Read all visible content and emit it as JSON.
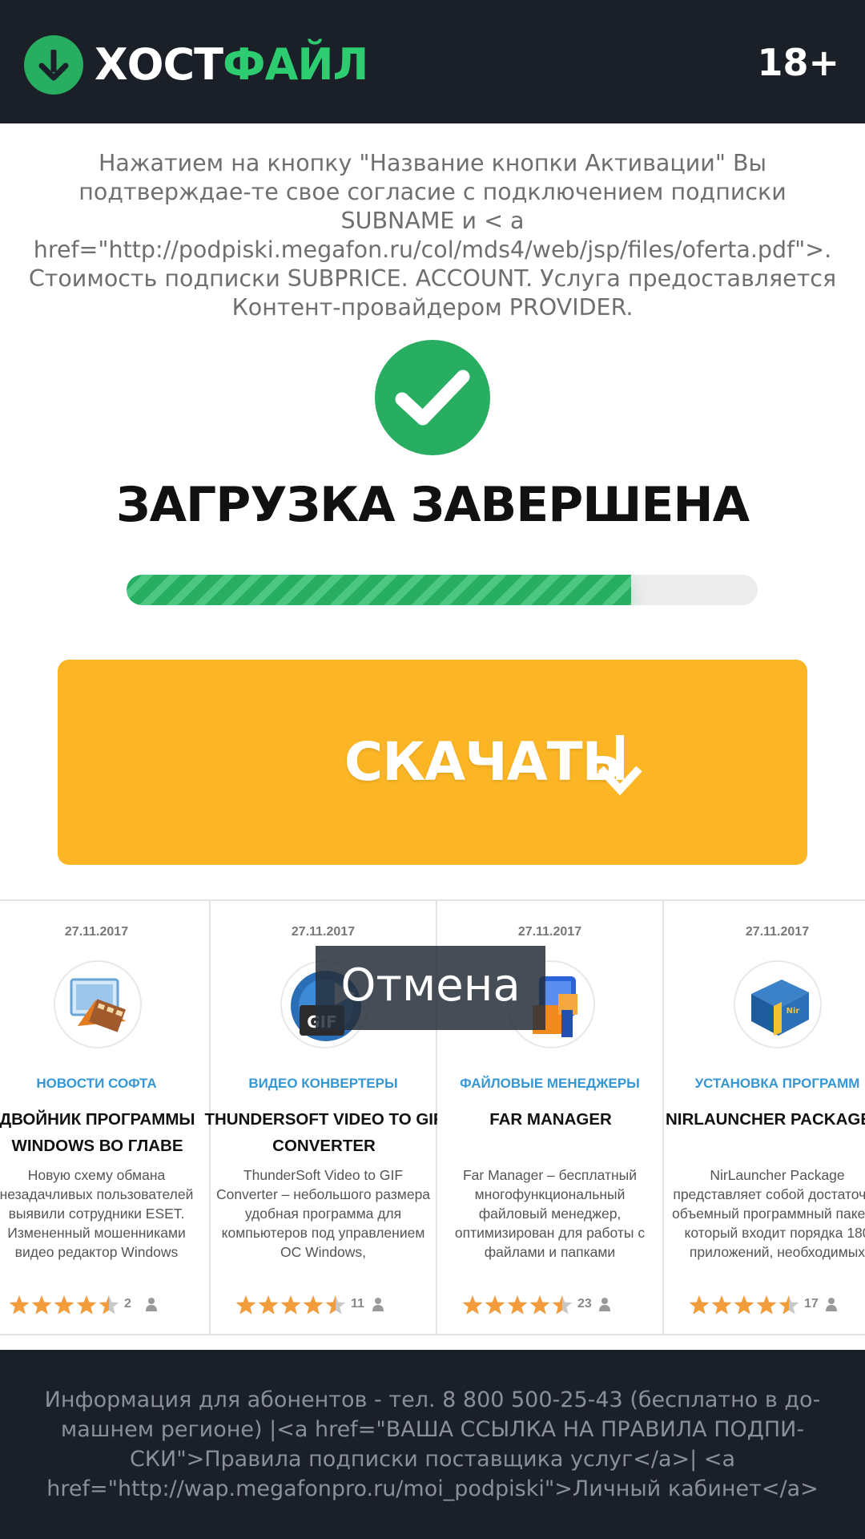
{
  "header": {
    "logo_part1": "ХОСТ",
    "logo_part2": "ФАЙЛ",
    "logo_icon": "download-arrow-icon",
    "age_badge": "18+"
  },
  "notice": "Нажатием на кнопку \"Название кнопки Активации\" Вы подтверждае-те свое согласие с подключением подписки SUBNAME и < a href=\"http://podpiski.megafon.ru/col/mds4/web/jsp/files/oferta.pdf\">. Стоимость подписки SUBPRICE. ACCOUNT. Услуга предоставляется Контент-провайдером PROVIDER.",
  "status": {
    "icon": "check-icon",
    "title": "ЗАГРУЗКА ЗАВЕРШЕНА",
    "progress_fraction": 0.8
  },
  "download_button": {
    "label": "СКАЧАТЬ",
    "icon": "arrow-down-icon"
  },
  "cards": [
    {
      "date": "27.11.2017",
      "category": "НОВОСТИ СОФТА",
      "title": "ДВОЙНИК ПРОГРАММЫ WINDOWS ВО ГЛАВЕ",
      "description": "Новую схему обмана незадачливых пользователей выявили сотрудники ESET. Измененный мошенниками видео редактор Windows",
      "rating": 4.5,
      "count": "2",
      "icon": "movie-maker-icon"
    },
    {
      "date": "27.11.2017",
      "category": "ВИДЕО КОНВЕРТЕРЫ",
      "title": "THUNDERSOFT VIDEO TO GIF CONVERTER",
      "description": "ThunderSoft Video to GIF Converter – небольшого размера удобная программа для компьютеров под управлением ОС Windows, преобразовывающая",
      "rating": 4.5,
      "count": "11",
      "icon": "gif-converter-icon"
    },
    {
      "date": "27.11.2017",
      "category": "ФАЙЛОВЫЕ МЕНЕДЖЕРЫ",
      "title": "FAR MANAGER",
      "description": "Far Manager – бесплатный многофункциональный файловый менеджер, оптимизирован для работы с файлами и папками операционных систем",
      "rating": 4.5,
      "count": "23",
      "icon": "far-manager-icon"
    },
    {
      "date": "27.11.2017",
      "category": "УСТАНОВКА ПРОГРАММ",
      "title": "NIRLAUNCHER PACKAGE",
      "description": "NirLauncher Package представляет собой достаточно объемный программный пакет в который входит порядка 180 приложений, необходимых",
      "rating": 4.5,
      "count": "17",
      "icon": "nirlauncher-box-icon"
    }
  ],
  "cancel_overlay": "Отмена",
  "footer": "Информация для абонентов - тел. 8 800 500-25-43 (бесплатно в до-машнем регионе) |<a href=\"ВАША ССЫЛКА НА ПРАВИЛА ПОДПИ-СКИ\">Правила подписки поставщика услуг</a>| <a href=\"http://wap.megafonpro.ru/moi_podpiski\">Личный кабинет</a>"
}
